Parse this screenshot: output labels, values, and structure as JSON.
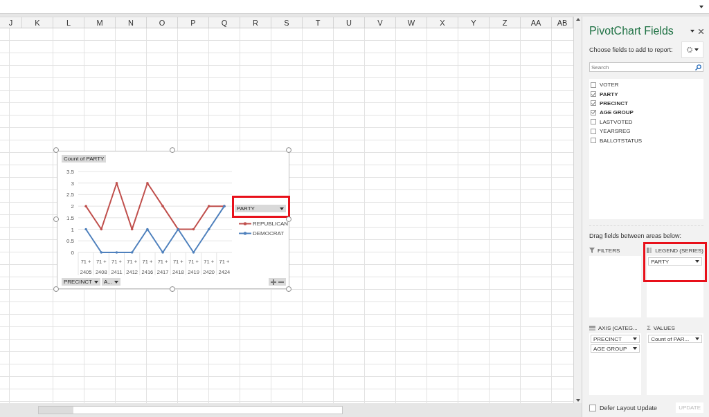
{
  "columns": [
    "J",
    "K",
    "L",
    "M",
    "N",
    "O",
    "P",
    "Q",
    "R",
    "S",
    "T",
    "U",
    "V",
    "W",
    "X",
    "Y",
    "Z",
    "AA",
    "AB"
  ],
  "chart": {
    "value_button": "Count of PARTY",
    "legend_button": {
      "label": "PARTY",
      "highlighted": true
    },
    "outer_labels": [
      "71 +",
      "71 +",
      "71 +",
      "71 +",
      "71 +",
      "71 +",
      "71 +",
      "71 +",
      "71 +",
      "71 +"
    ],
    "axis_buttons": [
      "PRECINCT",
      "A..."
    ],
    "chart_data": {
      "type": "line",
      "grid": true,
      "categories": [
        "2405",
        "2408",
        "2411",
        "2412",
        "2416",
        "2417",
        "2418",
        "2419",
        "2420",
        "2424"
      ],
      "ylim": [
        0,
        3.5
      ],
      "yticks": [
        0,
        0.5,
        1,
        1.5,
        2,
        2.5,
        3,
        3.5
      ],
      "series": [
        {
          "name": "REPUBLICAN",
          "color": "#c0504d",
          "values": [
            2,
            1,
            3,
            1,
            3,
            2,
            1,
            1,
            2,
            2
          ]
        },
        {
          "name": "DEMOCRAT",
          "color": "#4f81bd",
          "values": [
            1,
            0,
            0,
            0,
            1,
            0,
            1,
            0,
            1,
            2
          ]
        }
      ]
    }
  },
  "panel": {
    "title": "PivotChart Fields",
    "choose_label": "Choose fields to add to report:",
    "search": {
      "placeholder": "Search"
    },
    "fields": [
      {
        "label": "VOTER",
        "checked": false
      },
      {
        "label": "PARTY",
        "checked": true
      },
      {
        "label": "PRECINCT",
        "checked": true
      },
      {
        "label": "AGE GROUP",
        "checked": true
      },
      {
        "label": "LASTVOTED",
        "checked": false
      },
      {
        "label": "YEARSREG",
        "checked": false
      },
      {
        "label": "BALLOTSTATUS",
        "checked": false
      }
    ],
    "drag_label": "Drag fields between areas below:",
    "areas": [
      {
        "kind": "filters",
        "title": "FILTERS",
        "highlighted": false
      },
      {
        "kind": "legend",
        "title": "LEGEND (SERIES)",
        "highlighted": true,
        "items": [
          "PARTY"
        ]
      },
      {
        "kind": "axis",
        "title": "AXIS (CATEG...",
        "highlighted": false,
        "items": [
          "PRECINCT",
          "AGE GROUP"
        ]
      },
      {
        "kind": "values",
        "symbol": "Σ",
        "title": "VALUES",
        "highlighted": false,
        "items": [
          "Count of PAR..."
        ]
      }
    ],
    "defer": {
      "label": "Defer Layout Update",
      "checked": false
    },
    "update_button": {
      "label": "UPDATE",
      "disabled": true
    }
  }
}
